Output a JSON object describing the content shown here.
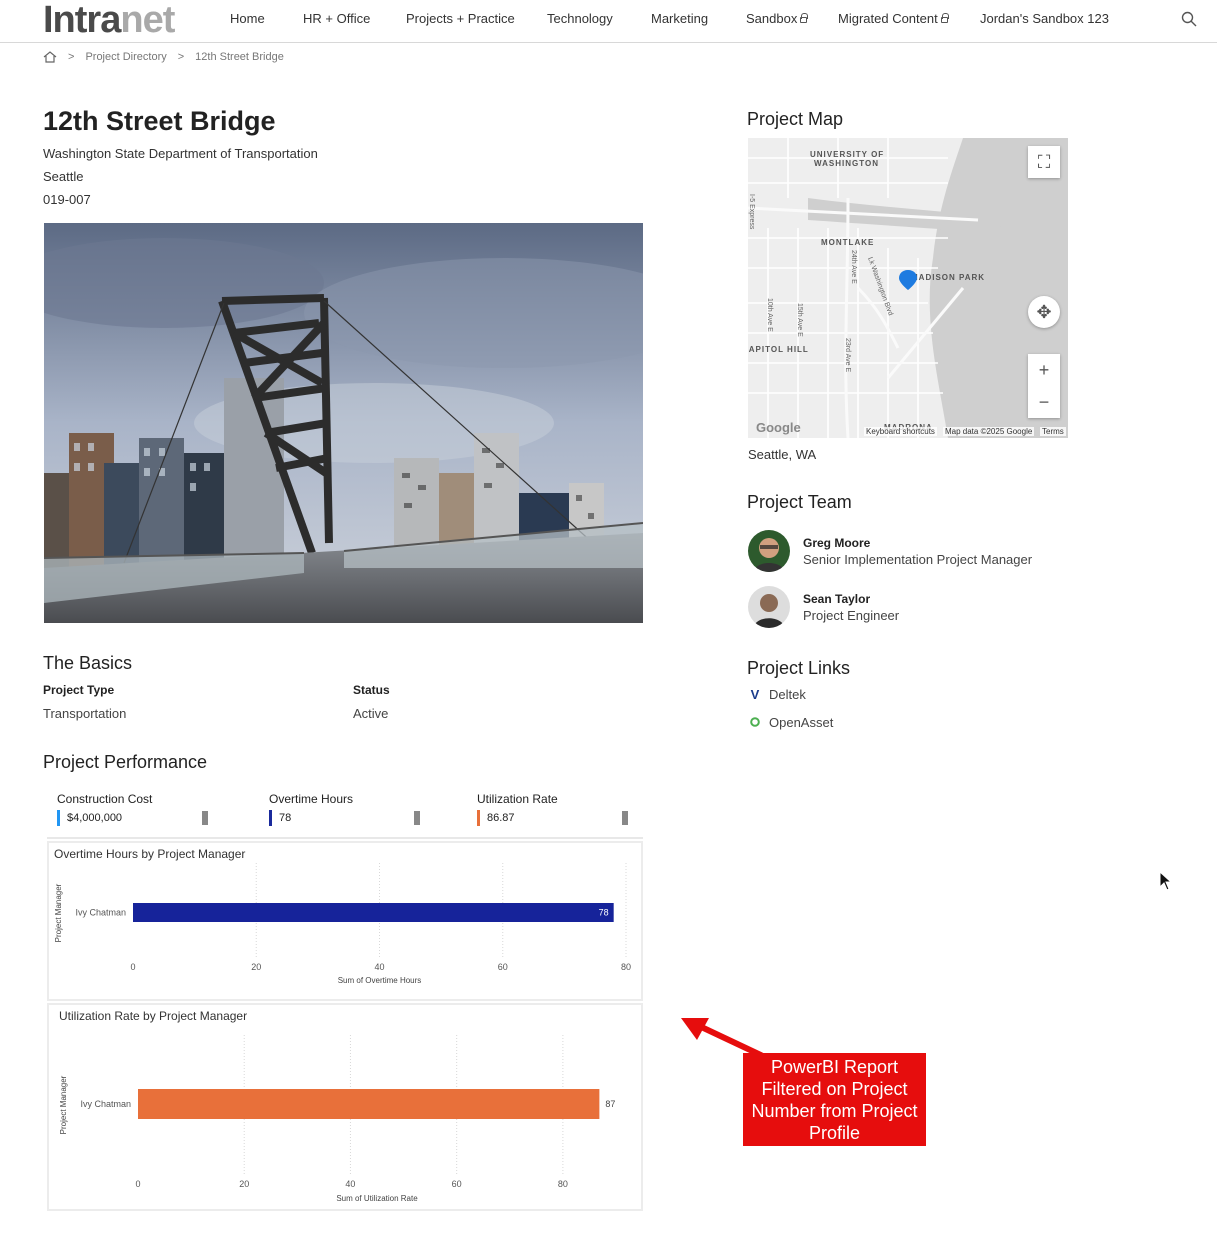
{
  "nav": {
    "logo_a": "Intra",
    "logo_b": "net",
    "items": [
      "Home",
      "HR + Office",
      "Projects + Practice",
      "Technology",
      "Marketing",
      "Sandbox",
      "Migrated Content",
      "Jordan's Sandbox 123"
    ],
    "icons": {
      "search": "search-icon",
      "lock": "lock-icon",
      "home": "home-icon"
    }
  },
  "breadcrumb": {
    "items": [
      "Project Directory",
      "12th Street Bridge"
    ]
  },
  "project": {
    "title": "12th Street Bridge",
    "client": "Washington State Department of Transportation",
    "city": "Seattle",
    "number": "019-007"
  },
  "basics": {
    "heading": "The Basics",
    "type_label": "Project Type",
    "type_value": "Transportation",
    "status_label": "Status",
    "status_value": "Active"
  },
  "performance": {
    "heading": "Project Performance",
    "kpis": [
      {
        "label": "Construction Cost",
        "value": "$4,000,000",
        "color": "#2196f3"
      },
      {
        "label": "Overtime Hours",
        "value": "78",
        "color": "#1a2a9c"
      },
      {
        "label": "Utilization Rate",
        "value": "86.87",
        "color": "#e8703a"
      }
    ]
  },
  "chart_data": [
    {
      "type": "bar",
      "title": "Overtime Hours by Project Manager",
      "categories": [
        "Ivy Chatman"
      ],
      "values": [
        78
      ],
      "data_labels": [
        "78"
      ],
      "xlabel": "Sum of Overtime Hours",
      "ylabel": "Project Manager",
      "xlim": [
        0,
        80
      ],
      "ticks": [
        "0",
        "20",
        "40",
        "60",
        "80"
      ],
      "color": "#16239a"
    },
    {
      "type": "bar",
      "title": "Utilization Rate by Project Manager",
      "categories": [
        "Ivy Chatman"
      ],
      "values": [
        86.87
      ],
      "data_labels": [
        "87"
      ],
      "xlabel": "Sum of Utilization Rate",
      "ylabel": "Project Manager",
      "xlim": [
        0,
        90
      ],
      "ticks": [
        "0",
        "20",
        "40",
        "60",
        "80"
      ],
      "color": "#e8703a"
    }
  ],
  "map": {
    "heading": "Project Map",
    "location": "Seattle, WA",
    "labels": {
      "uw1": "UNIVERSITY OF",
      "uw2": "WASHINGTON",
      "montlake": "MONTLAKE",
      "madison": "MADISON PARK",
      "capitol": "CAPITOL HILL",
      "madrona": "MADRONA",
      "s10": "10th Ave E",
      "s24": "24th Ave E",
      "s15": "15th Ave E",
      "s23": "23rd Ave E",
      "lk": "Lk Washington Blvd",
      "express": "I-5 Express"
    },
    "footer": {
      "google": "Google",
      "shortcuts": "Keyboard shortcuts",
      "data": "Map data ©2025 Google",
      "terms": "Terms"
    }
  },
  "team": {
    "heading": "Project Team",
    "members": [
      {
        "name": "Greg Moore",
        "role": "Senior Implementation Project Manager"
      },
      {
        "name": "Sean Taylor",
        "role": "Project Engineer"
      }
    ]
  },
  "links": {
    "heading": "Project Links",
    "items": [
      {
        "icon": "V",
        "label": "Deltek",
        "color": "#1a3c8c"
      },
      {
        "icon": "O",
        "label": "OpenAsset",
        "color": "#4caf50"
      }
    ]
  },
  "callout": {
    "text": "PowerBI Report Filtered on Project Number from Project Profile"
  }
}
